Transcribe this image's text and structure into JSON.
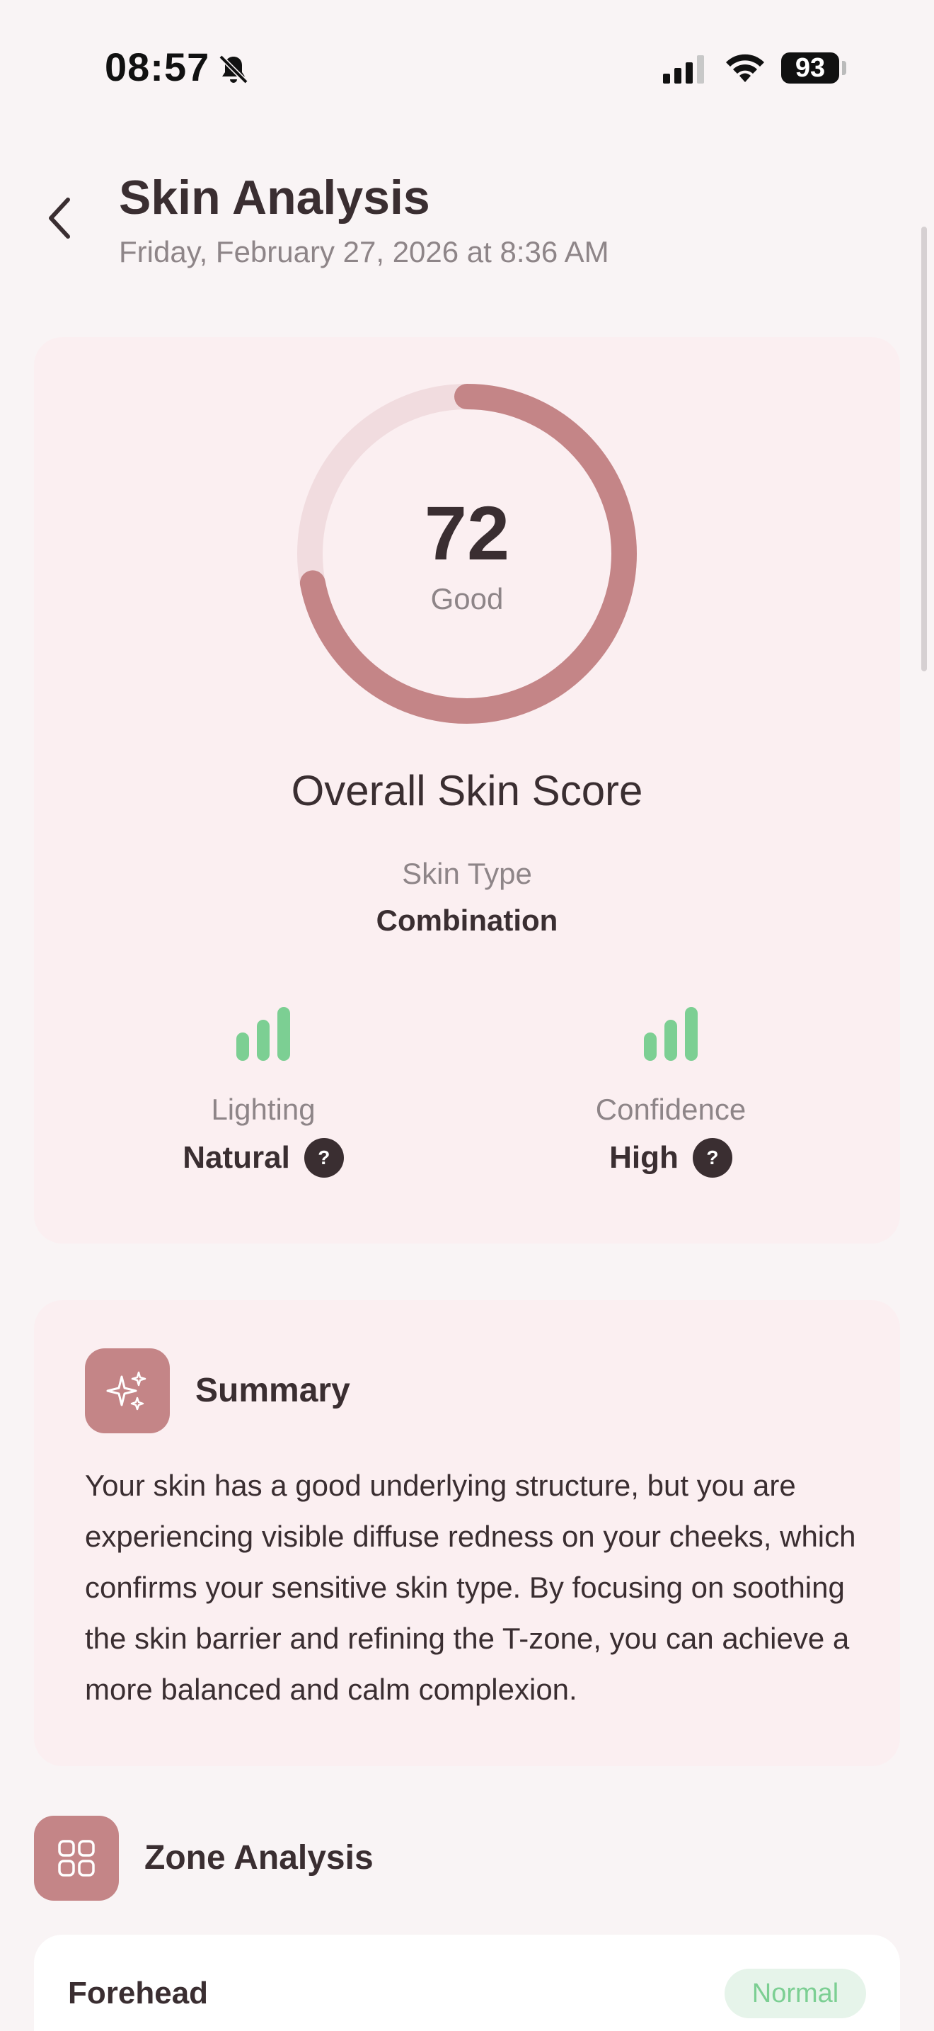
{
  "status_bar": {
    "time": "08:57",
    "battery": "93"
  },
  "header": {
    "title": "Skin Analysis",
    "subtitle": "Friday, February 27, 2026 at 8:36 AM"
  },
  "score_card": {
    "score": "72",
    "score_fraction": 0.72,
    "grade": "Good",
    "title": "Overall Skin Score",
    "skin_type_label": "Skin Type",
    "skin_type_value": "Combination",
    "metrics": [
      {
        "label": "Lighting",
        "value": "Natural",
        "help": "?"
      },
      {
        "label": "Confidence",
        "value": "High",
        "help": "?"
      }
    ]
  },
  "summary": {
    "title": "Summary",
    "text": "Your skin has a good underlying structure, but you are experiencing visible diffuse redness on your cheeks, which confirms your sensitive skin type. By focusing on soothing the skin barrier and refining the T-zone, you can achieve a more balanced and calm complexion."
  },
  "zone_analysis": {
    "title": "Zone Analysis",
    "zones": [
      {
        "name": "Forehead",
        "status": "Normal"
      }
    ]
  },
  "colors": {
    "accent": "#c48587",
    "ring_track": "#f1dcdf",
    "bars_good": "#7ccf93",
    "card_bg": "#fbeff1",
    "page_bg": "#f9f4f5",
    "text_primary": "#3a2e31",
    "text_secondary": "#8e8588"
  },
  "icons": {
    "back": "chevron-left-icon",
    "silent": "bell-slash-icon",
    "summary": "sparkles-icon",
    "zone": "grid-icon"
  }
}
